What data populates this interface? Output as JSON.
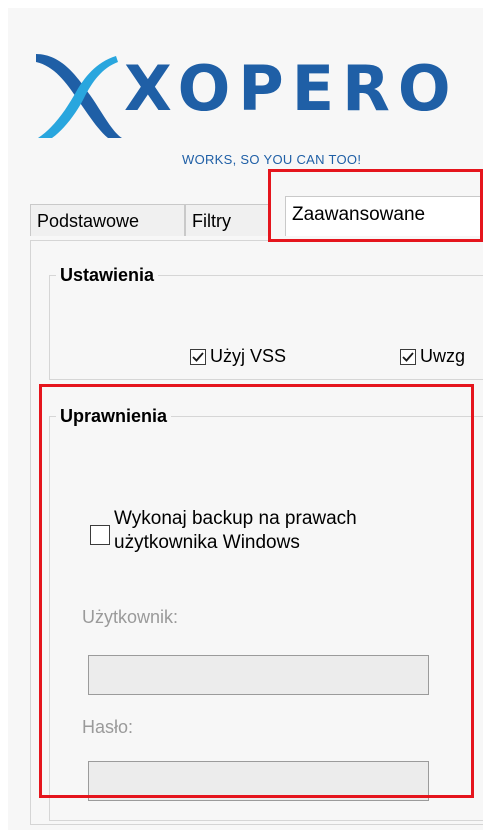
{
  "logo": {
    "wordmark": "XOPERO",
    "tagline": "WORKS, SO YOU CAN TOO!",
    "colors": {
      "brand_blue": "#1f5fa6",
      "accent_blue": "#29a6de"
    }
  },
  "tabs": [
    {
      "label": "Podstawowe",
      "active": false
    },
    {
      "label": "Filtry",
      "active": false
    },
    {
      "label": "Zaawansowane",
      "active": true
    }
  ],
  "ustawienia": {
    "title": "Ustawienia",
    "checkboxes": [
      {
        "label": "Użyj VSS",
        "checked": true
      },
      {
        "label": "Uwzg",
        "checked": true
      }
    ]
  },
  "uprawnienia": {
    "title": "Uprawnienia",
    "backup_checkbox": {
      "label": "Wykonaj backup na prawach użytkownika Windows",
      "checked": false
    },
    "user_label": "Użytkownik:",
    "user_value": "",
    "password_label": "Hasło:",
    "password_value": ""
  },
  "highlight_color": "#e5151d"
}
